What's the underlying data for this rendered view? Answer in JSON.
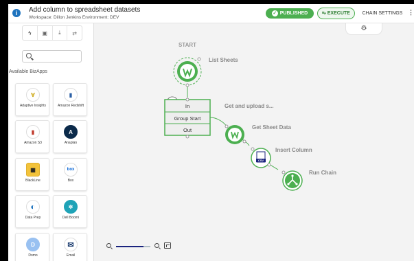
{
  "header": {
    "title": "Add column to spreadsheet datasets",
    "subtitle": "Workspace: Dillon Jenkins Environment: DEV",
    "published_label": "PUBLISHED",
    "execute_label": "EXECUTE",
    "settings_label": "CHAIN SETTINGS",
    "more_glyph": "⋮",
    "gear_glyph": "⚙"
  },
  "sidebar": {
    "tabs": [
      {
        "icon": "lightning-icon",
        "glyph": "ϟ"
      },
      {
        "icon": "calendar-icon",
        "glyph": "▣"
      },
      {
        "icon": "download-icon",
        "glyph": "⤓"
      },
      {
        "icon": "loop-icon",
        "glyph": "⇄"
      }
    ],
    "search_placeholder": "",
    "available_label": "Available BizApps",
    "apps": [
      {
        "label": "Adaptive Insights",
        "icon": "adaptive-insights-logo",
        "glyph": "∀",
        "color": "#c8a000"
      },
      {
        "label": "Amazon Redshift",
        "icon": "amazon-redshift-logo",
        "glyph": "▮",
        "color": "#2b5fa5"
      },
      {
        "label": "Amazon S3",
        "icon": "amazon-s3-logo",
        "glyph": "▮",
        "color": "#c0392b"
      },
      {
        "label": "Anaplan",
        "icon": "anaplan-logo",
        "glyph": "A",
        "color": "#0b2a4a"
      },
      {
        "label": "BlackLine",
        "icon": "blackline-logo",
        "glyph": "▦",
        "color": "#222222"
      },
      {
        "label": "Box",
        "icon": "box-logo",
        "glyph": "box",
        "color": "#0061d5"
      },
      {
        "label": "Data Prep",
        "icon": "data-prep-logo",
        "glyph": "◐",
        "color": "#1e73be"
      },
      {
        "label": "Dell Boomi",
        "icon": "dell-boomi-logo",
        "glyph": "✲",
        "color": "#1fa3b7"
      },
      {
        "label": "Domo",
        "icon": "domo-logo",
        "glyph": "D",
        "color": "#99c1f1"
      },
      {
        "label": "Email",
        "icon": "email-logo",
        "glyph": "✉",
        "color": "#1a3b6e"
      }
    ]
  },
  "canvas": {
    "start_label": "START",
    "list_sheets_label": "List Sheets",
    "group_caption": "Get and upload s...",
    "group_rows": [
      "In",
      "Group Start",
      "Out"
    ],
    "get_sheet_label": "Get Sheet Data",
    "insert_column_label": "Insert Column",
    "run_chain_label": "Run Chain",
    "csv_label": "CSV",
    "accent": "#4caf50"
  },
  "zoom": {
    "level": 0.8
  }
}
